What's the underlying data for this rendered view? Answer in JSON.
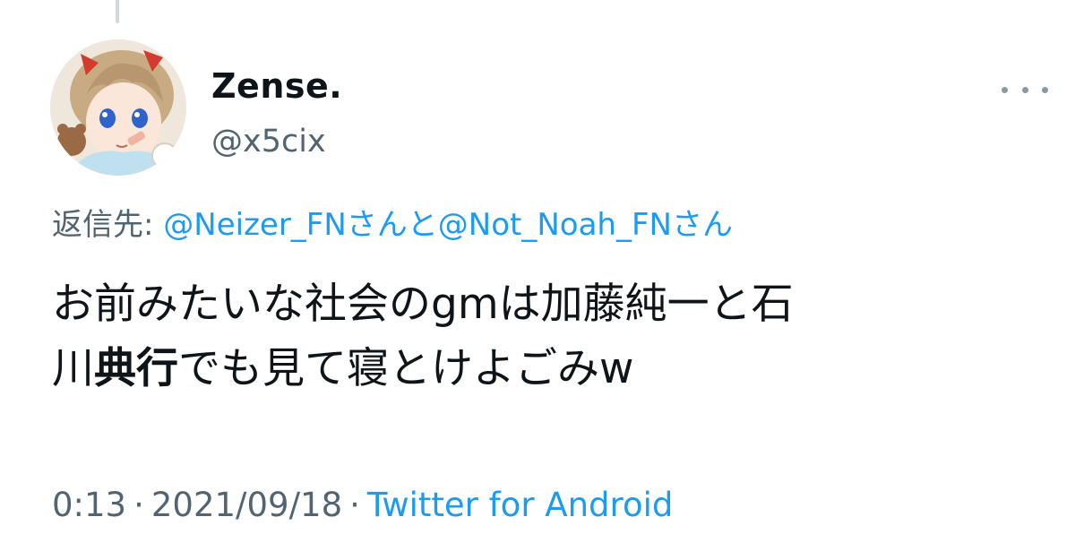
{
  "tweet": {
    "author": {
      "display_name": "Zense.",
      "handle": "@x5cix"
    },
    "reply_to": {
      "prefix": "返信先: ",
      "mention1": "@Neizer_FN",
      "joiner": "さんと",
      "mention2": "@Not_Noah_FN",
      "suffix": "さん"
    },
    "text": {
      "line1": "お前みたいな社会のgmは加藤純一と石",
      "line2_start": "川",
      "line2_bold": "典行",
      "line2_end": "でも見て寝とけよごみw"
    },
    "meta": {
      "time": "0:13",
      "date": "2021/09/18",
      "separator": "·",
      "source": "Twitter for Android"
    }
  },
  "icons": {
    "more": "more-horizontal-icon",
    "avatar": "avatar-image"
  },
  "colors": {
    "link": "#1d9bf0",
    "secondary_text": "#536471",
    "primary_text": "#0f1419",
    "thread_line": "#cfd9de"
  }
}
